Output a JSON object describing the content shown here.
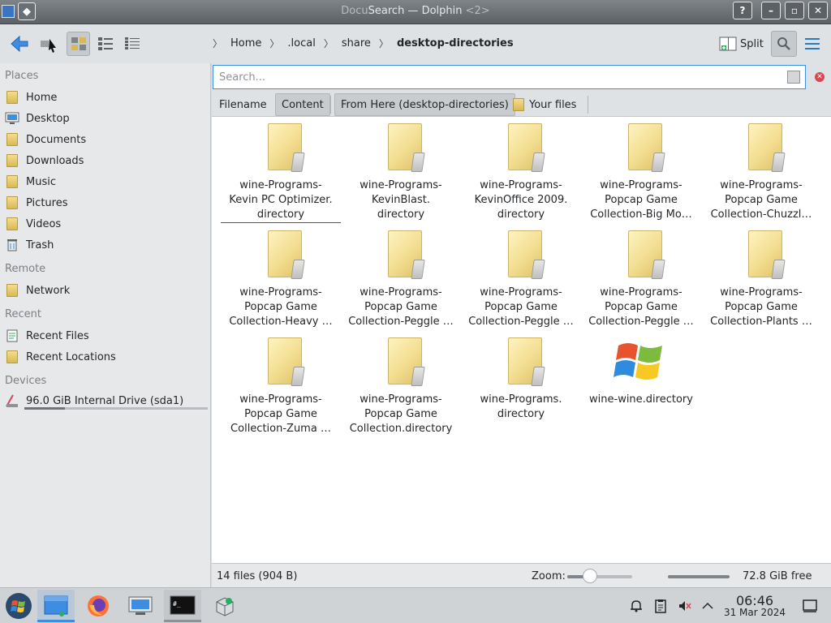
{
  "window": {
    "title_prefix": "Docu",
    "title": "Search — Dolphin",
    "title_suffix": "<2>"
  },
  "toolbar": {
    "split_label": "Split"
  },
  "breadcrumb": [
    "Home",
    ".local",
    "share",
    "desktop-directories"
  ],
  "sidebar": {
    "sections": {
      "places": "Places",
      "remote": "Remote",
      "recent": "Recent",
      "devices": "Devices"
    },
    "places": [
      {
        "label": "Home",
        "icon": "home-folder-icon"
      },
      {
        "label": "Desktop",
        "icon": "desktop-icon"
      },
      {
        "label": "Documents",
        "icon": "documents-folder-icon"
      },
      {
        "label": "Downloads",
        "icon": "downloads-folder-icon"
      },
      {
        "label": "Music",
        "icon": "music-folder-icon"
      },
      {
        "label": "Pictures",
        "icon": "pictures-folder-icon"
      },
      {
        "label": "Videos",
        "icon": "videos-folder-icon"
      },
      {
        "label": "Trash",
        "icon": "trash-icon"
      }
    ],
    "remote": [
      {
        "label": "Network",
        "icon": "network-folder-icon"
      }
    ],
    "recent": [
      {
        "label": "Recent Files",
        "icon": "recent-files-icon"
      },
      {
        "label": "Recent Locations",
        "icon": "recent-locations-icon"
      }
    ],
    "devices": [
      {
        "label": "96.0 GiB Internal Drive (sda1)",
        "icon": "hard-drive-icon",
        "usage_fraction": 0.22
      }
    ]
  },
  "search": {
    "placeholder": "Search...",
    "value": ""
  },
  "filters": {
    "filename": "Filename",
    "content": "Content",
    "from_here": "From Here (desktop-directories)",
    "your_files": "Your files"
  },
  "files": [
    {
      "label": "wine-Programs-\nKevin PC Optimizer.\ndirectory",
      "icon": "folder-icon",
      "selected": true
    },
    {
      "label": "wine-Programs-\nKevinBlast.\ndirectory",
      "icon": "folder-icon"
    },
    {
      "label": "wine-Programs-\nKevinOffice 2009.\ndirectory",
      "icon": "folder-icon"
    },
    {
      "label": "wine-Programs-\nPopcap Game\nCollection-Big Mo…",
      "icon": "folder-icon"
    },
    {
      "label": "wine-Programs-\nPopcap Game\nCollection-Chuzzl…",
      "icon": "folder-icon"
    },
    {
      "label": "wine-Programs-\nPopcap Game\nCollection-Heavy …",
      "icon": "folder-icon"
    },
    {
      "label": "wine-Programs-\nPopcap Game\nCollection-Peggle …",
      "icon": "folder-icon"
    },
    {
      "label": "wine-Programs-\nPopcap Game\nCollection-Peggle …",
      "icon": "folder-icon"
    },
    {
      "label": "wine-Programs-\nPopcap Game\nCollection-Peggle …",
      "icon": "folder-icon"
    },
    {
      "label": "wine-Programs-\nPopcap Game\nCollection-Plants …",
      "icon": "folder-icon"
    },
    {
      "label": "wine-Programs-\nPopcap Game\nCollection-Zuma …",
      "icon": "folder-icon"
    },
    {
      "label": "wine-Programs-\nPopcap Game\nCollection.directory",
      "icon": "folder-icon"
    },
    {
      "label": "wine-Programs.\ndirectory",
      "icon": "folder-icon"
    },
    {
      "label": "wine-wine.directory",
      "icon": "windows-logo-icon"
    }
  ],
  "status": {
    "count": "14 files (904 B)",
    "zoom_label": "Zoom:",
    "zoom_level": 0.35,
    "free_space": "72.8 GiB free"
  },
  "taskbar": {
    "apps": [
      {
        "name": "start-menu-button",
        "icon": "windows-logo-icon"
      },
      {
        "name": "dolphin-task",
        "icon": "file-manager-icon",
        "state": "active"
      },
      {
        "name": "firefox-task",
        "icon": "firefox-icon"
      },
      {
        "name": "system-settings-task",
        "icon": "settings-icon"
      },
      {
        "name": "terminal-task",
        "icon": "terminal-icon",
        "state": "open"
      },
      {
        "name": "software-center-task",
        "icon": "package-icon"
      }
    ],
    "clock_time": "06:46",
    "clock_date": "31 Mar 2024"
  },
  "colors": {
    "accent": "#3d8ee3",
    "folder": "#f2dd8f",
    "close_red": "#da4453"
  }
}
